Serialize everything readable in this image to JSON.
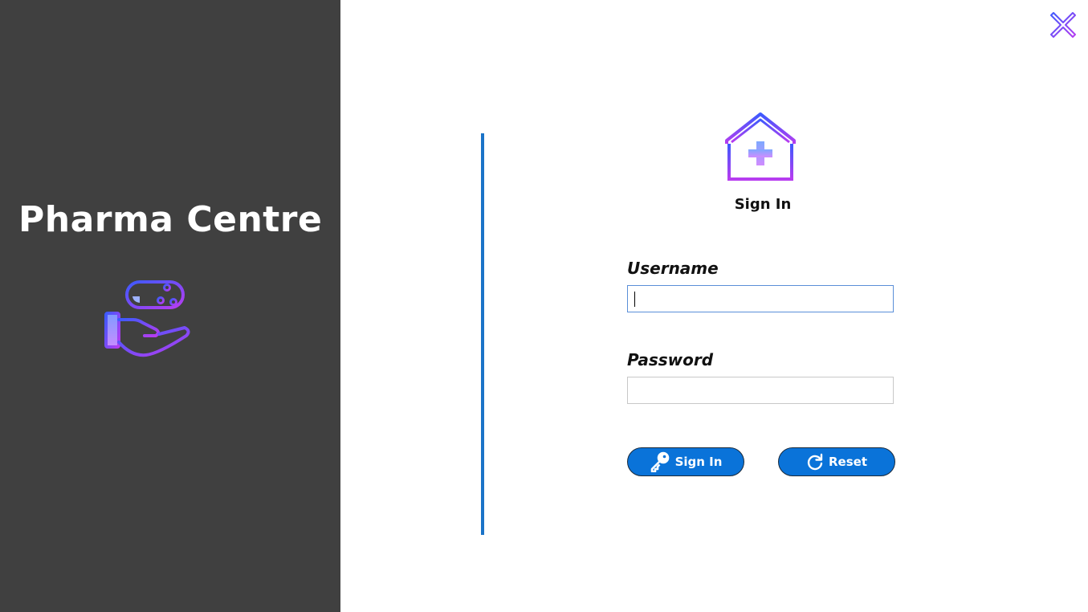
{
  "app": {
    "title": "Pharma Centre",
    "pharma_icon": "hand-holding-pill-icon",
    "close_icon": "close-icon"
  },
  "form": {
    "heading": "Sign In",
    "header_icon": "clinic-house-icon",
    "username": {
      "label": "Username",
      "value": "",
      "placeholder": ""
    },
    "password": {
      "label": "Password",
      "value": "",
      "placeholder": ""
    },
    "buttons": {
      "signin_label": "Sign In",
      "signin_icon": "key-icon",
      "reset_label": "Reset",
      "reset_icon": "refresh-icon"
    }
  },
  "colors": {
    "sidebar_bg": "#404040",
    "accent": "#0a73d9",
    "divider": "#1a73c8",
    "icon_gradient_start": "#3d5afe",
    "icon_gradient_end": "#b83cf0"
  }
}
